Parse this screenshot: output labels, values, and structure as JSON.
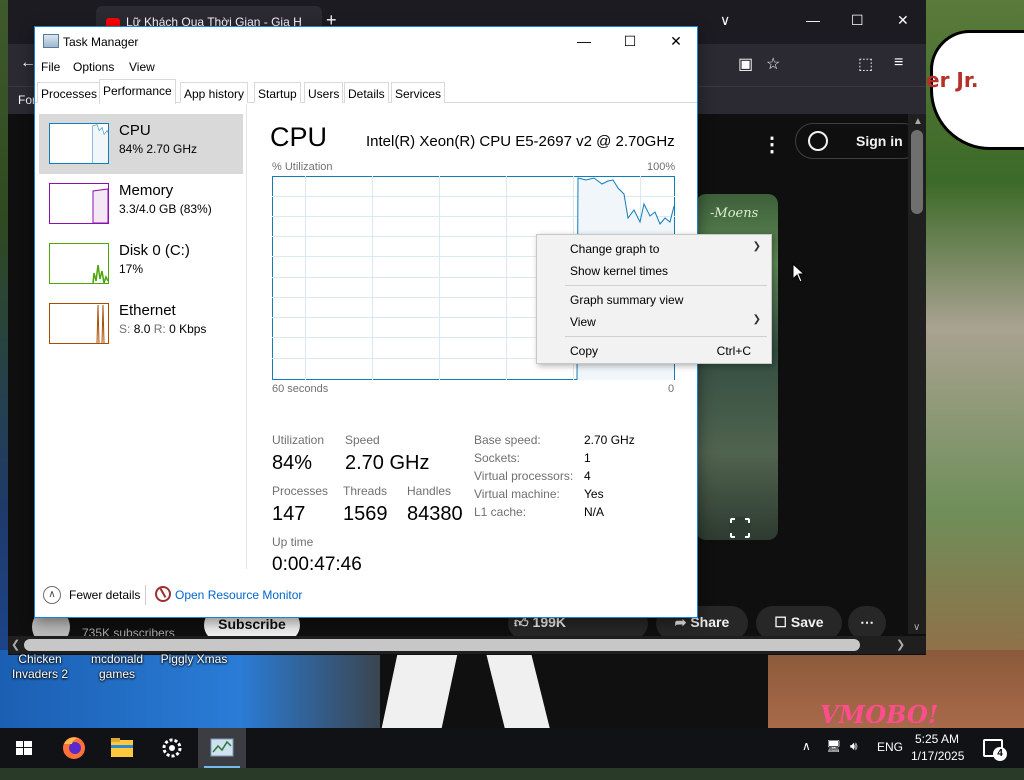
{
  "browser": {
    "tab_title": "Lữ Khách Qua Thời Gian - Gia H",
    "bookmark_text": "For",
    "sign_in": "Sign in",
    "video_overlay_text": "-Moens",
    "subscribers": "735K subscribers",
    "subscribe": "Subscribe",
    "likes": "199K",
    "share": "Share",
    "save": "Save"
  },
  "desktop": {
    "speech_text": "er Jr.",
    "watermark": "VMOBO!",
    "icons": [
      {
        "label1": "Chicken",
        "label2": "Invaders 2"
      },
      {
        "label1": "mcdonald",
        "label2": "games"
      },
      {
        "label1": "Piggly Xmas",
        "label2": ""
      }
    ]
  },
  "taskmanager": {
    "title": "Task Manager",
    "menu": [
      "File",
      "Options",
      "View"
    ],
    "tabs": [
      "Processes",
      "Performance",
      "App history",
      "Startup",
      "Users",
      "Details",
      "Services"
    ],
    "active_tab": "Performance",
    "resources": [
      {
        "name": "CPU",
        "sub": "84% 2.70 GHz",
        "color": "#117dbb",
        "selected": true
      },
      {
        "name": "Memory",
        "sub": "3.3/4.0 GB (83%)",
        "color": "#8b12ae",
        "selected": false
      },
      {
        "name": "Disk 0 (C:)",
        "sub": "17%",
        "color": "#4da60c",
        "selected": false
      },
      {
        "name": "Ethernet",
        "sub_s_label": "S:",
        "sub_s": "8.0",
        "sub_r_label": "R:",
        "sub_r": "0 Kbps",
        "color": "#a74f01",
        "selected": false
      }
    ],
    "cpu": {
      "heading": "CPU",
      "model": "Intel(R) Xeon(R) CPU E5-2697 v2 @ 2.70GHz",
      "util_label": "% Utilization",
      "util_max": "100%",
      "axis_left": "60 seconds",
      "axis_right": "0",
      "stats": {
        "utilization_label": "Utilization",
        "utilization": "84%",
        "speed_label": "Speed",
        "speed": "2.70 GHz",
        "processes_label": "Processes",
        "processes": "147",
        "threads_label": "Threads",
        "threads": "1569",
        "handles_label": "Handles",
        "handles": "84380",
        "uptime_label": "Up time",
        "uptime": "0:00:47:46"
      },
      "details": [
        {
          "label": "Base speed:",
          "value": "2.70 GHz"
        },
        {
          "label": "Sockets:",
          "value": "1"
        },
        {
          "label": "Virtual processors:",
          "value": "4"
        },
        {
          "label": "Virtual machine:",
          "value": "Yes"
        },
        {
          "label": "L1 cache:",
          "value": "N/A"
        }
      ]
    },
    "footer": {
      "fewer_details": "Fewer details",
      "resource_monitor": "Open Resource Monitor"
    }
  },
  "context_menu": {
    "items": [
      {
        "label": "Change graph to",
        "submenu": true
      },
      {
        "label": "Show kernel times",
        "submenu": false
      },
      {
        "label": "Graph summary view",
        "submenu": false
      },
      {
        "label": "View",
        "submenu": true
      },
      {
        "label": "Copy",
        "shortcut": "Ctrl+C"
      }
    ]
  },
  "taskbar": {
    "language": "ENG",
    "time": "5:25 AM",
    "date": "1/17/2025",
    "notifications": "4"
  }
}
